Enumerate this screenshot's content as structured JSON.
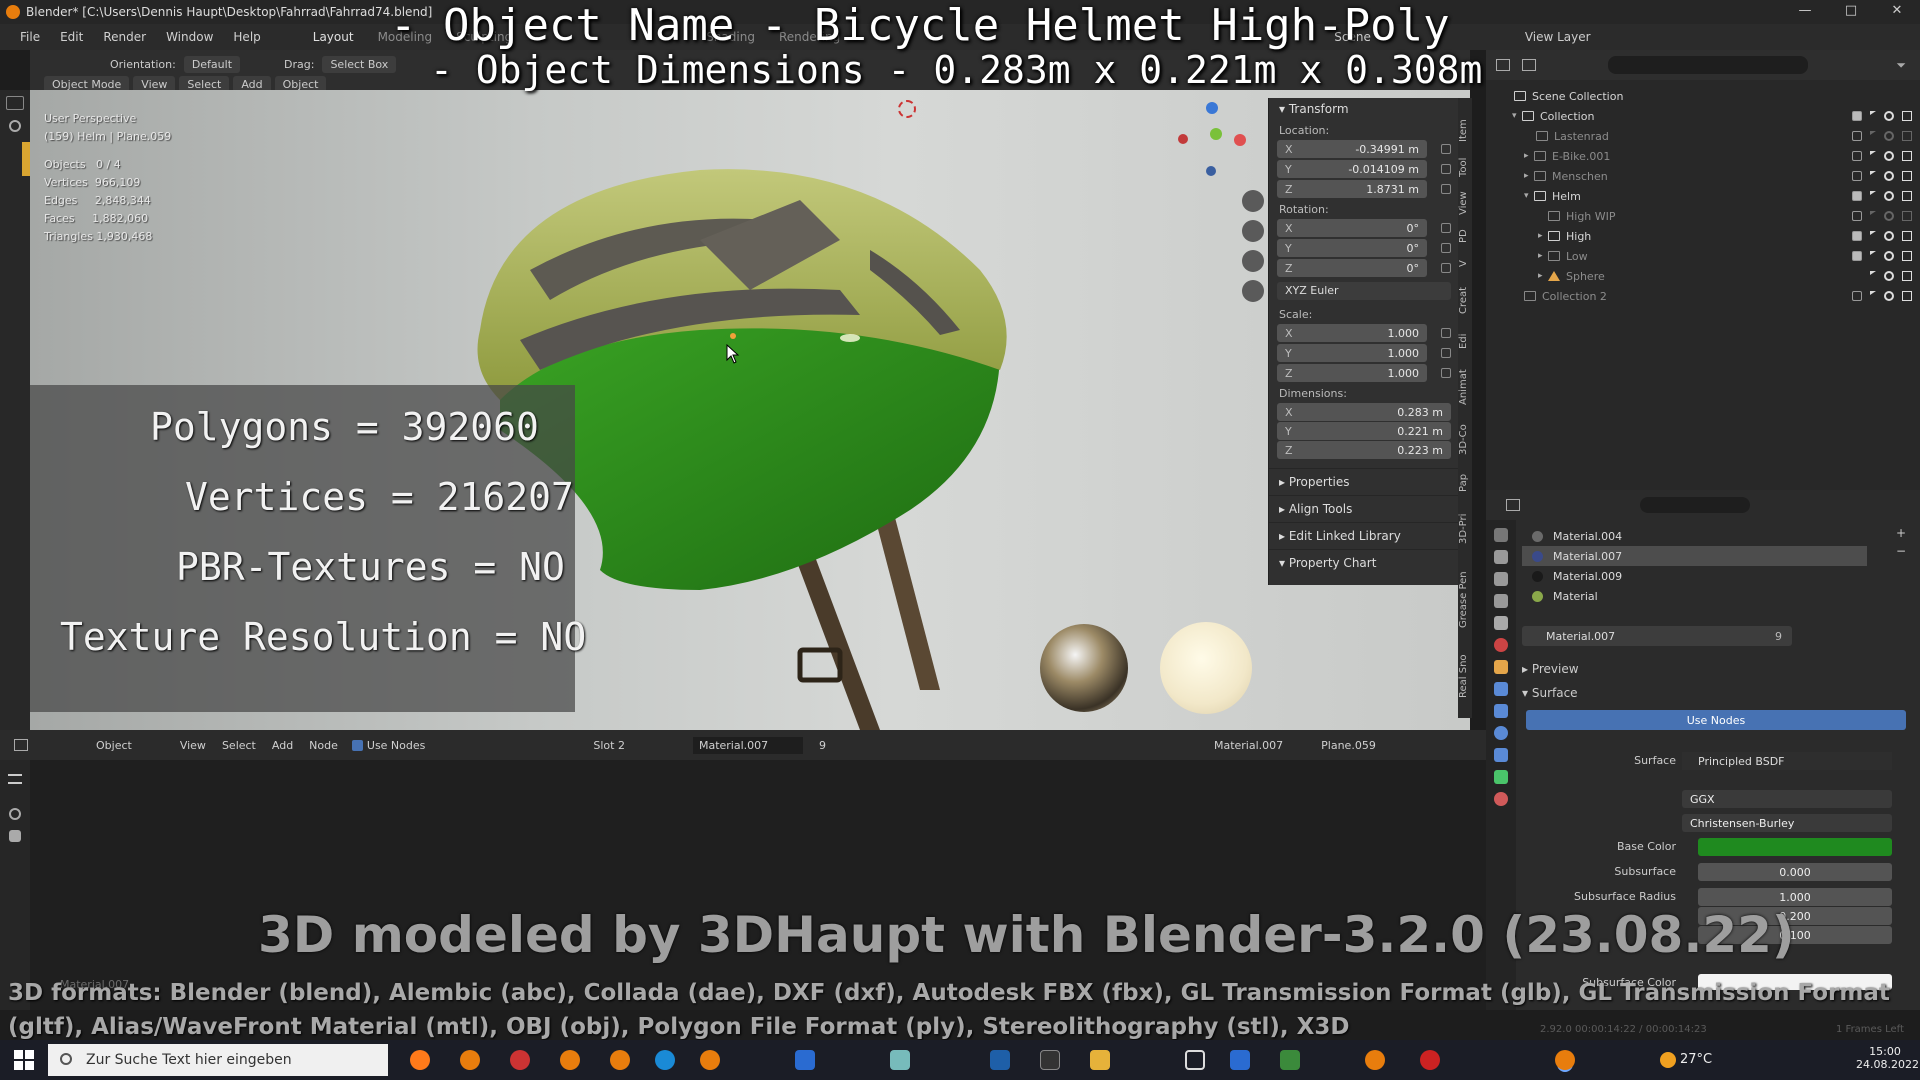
{
  "window": {
    "title": "Blender* [C:\\Users\\Dennis Haupt\\Desktop\\Fahrrad\\Fahrrad74.blend]",
    "min": "—",
    "max": "□",
    "close": "✕"
  },
  "menu": {
    "items": [
      "File",
      "Edit",
      "Render",
      "Window",
      "Help"
    ],
    "workspaces": [
      "Layout",
      "Modeling",
      "Sculpting",
      "Shading",
      "Rendering"
    ],
    "scene_label": "Scene",
    "view_layer_label": "View Layer"
  },
  "overlay": {
    "title_line1": "- Object Name - Bicycle Helmet High-Poly",
    "title_line2": "- Object Dimensions -  0.283m x 0.221m x 0.308m",
    "polygons": "Polygons = 392060",
    "vertices": "Vertices = 216207",
    "pbr": "PBR-Textures = NO",
    "texres": "Texture Resolution = NO",
    "credits": "3D modeled by 3DHaupt with Blender-3.2.0 (23.08.22)",
    "formats_line1": "3D formats: Blender (blend), Alembic (abc), Collada (dae), DXF (dxf), Autodesk FBX (fbx), GL Transmission Format (glb), GL Transmission Format",
    "formats_line2": "(gltf), Alias/WaveFront Material (mtl), OBJ (obj), Polygon File Format (ply), Stereolithography (stl), X3D"
  },
  "viewport_header": {
    "mode": "Object Mode",
    "menus": [
      "View",
      "Select",
      "Add",
      "Object"
    ],
    "orientation_label": "Orientation:",
    "orientation": "Default",
    "drag_label": "Drag:",
    "drag": "Select Box"
  },
  "viewport_info": {
    "perspective": "User Perspective",
    "collection": "(159) Helm | Plane.059",
    "stats": [
      "Objects   0 / 4",
      "Vertices  966,109",
      "Edges     2,848,344",
      "Faces     1,882,060",
      "Triangles 1,930,468"
    ]
  },
  "npanel": {
    "transform": "Transform",
    "location_label": "Location:",
    "location": {
      "x": "-0.34991 m",
      "y": "-0.014109 m",
      "z": "1.8731 m"
    },
    "rotation_label": "Rotation:",
    "rotation": {
      "x": "0°",
      "y": "0°",
      "z": "0°"
    },
    "rotation_mode": "XYZ Euler",
    "scale_label": "Scale:",
    "scale": {
      "x": "1.000",
      "y": "1.000",
      "z": "1.000"
    },
    "dimensions_label": "Dimensions:",
    "dimensions": {
      "x": "0.283 m",
      "y": "0.221 m",
      "z": "0.223 m"
    },
    "sections": [
      "Properties",
      "Align Tools",
      "Edit Linked Library",
      "Property Chart"
    ],
    "axes": {
      "x": "X",
      "y": "Y",
      "z": "Z"
    }
  },
  "vtabs": [
    "Item",
    "Tool",
    "View",
    "PD",
    "V",
    "Creat",
    "Edi",
    "Animat",
    "3D-Co",
    "Pap",
    "3D-Pri",
    "Grease Pen",
    "Real Sno"
  ],
  "outliner": {
    "root": "Scene Collection",
    "rows": [
      {
        "label": "Collection",
        "indent": 1
      },
      {
        "label": "Lastenrad",
        "indent": 2
      },
      {
        "label": "E-Bike.001",
        "indent": 2
      },
      {
        "label": "Menschen",
        "indent": 2
      },
      {
        "label": "Helm",
        "indent": 2
      },
      {
        "label": "High WIP",
        "indent": 3
      },
      {
        "label": "High",
        "indent": 3
      },
      {
        "label": "Low",
        "indent": 3
      },
      {
        "label": "Sphere",
        "indent": 3
      },
      {
        "label": "Collection 2",
        "indent": 1
      }
    ]
  },
  "materials": {
    "slots": [
      {
        "name": "Material.004",
        "color": "#6a6a6a"
      },
      {
        "name": "Material.007",
        "color": "#3a4a8a"
      },
      {
        "name": "Material.009",
        "color": "#1a1a1a"
      },
      {
        "name": "Material",
        "color": "#8aa84a"
      }
    ],
    "active": "Material.007",
    "users": "9",
    "preview": "Preview",
    "surface_section": "Surface",
    "use_nodes": "Use Nodes",
    "surface_label": "Surface",
    "surface_value": "Principled BSDF",
    "distribution": "GGX",
    "subsurface_method": "Christensen-Burley",
    "base_color_label": "Base Color",
    "base_color": "#1f8a1f",
    "subsurface_label": "Subsurface",
    "subsurface": "0.000",
    "subsurface_radius_label": "Subsurface Radius",
    "subsurface_radius": [
      "1.000",
      "0.200",
      "0.100"
    ],
    "subsurface_color_label": "Subsurface Color"
  },
  "node_header": {
    "editor": "Object",
    "menus": [
      "View",
      "Select",
      "Add",
      "Node"
    ],
    "use_nodes": "Use Nodes",
    "slot": "Slot 2",
    "material": "Material.007",
    "users": "9",
    "right_material": "Material.007",
    "object": "Plane.059",
    "node_name": "Material.007"
  },
  "status": {
    "version": "2.92.0  00:00:14:22 / 00:00:14:23",
    "frames_left": "1 Frames Left"
  },
  "taskbar": {
    "search_placeholder": "Zur Suche Text hier eingeben",
    "temp": "27°C",
    "time": "15:00",
    "date": "24.08.2022"
  }
}
